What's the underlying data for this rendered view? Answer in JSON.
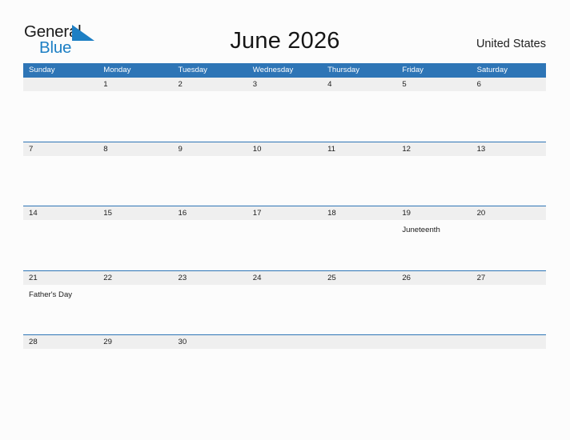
{
  "brand": {
    "name_part1": "General",
    "name_part2": "Blue",
    "flag_icon": "blue-triangle-flag-icon",
    "accent_color": "#1d7fc4"
  },
  "header": {
    "title": "June 2026",
    "country": "United States"
  },
  "theme": {
    "header_blue": "#2e75b6",
    "date_band_gray": "#efefef",
    "page_background": "#fcfcfc",
    "text_color": "#1c1c1c"
  },
  "calendar": {
    "month": "June",
    "year": "2026",
    "weekdays": [
      "Sunday",
      "Monday",
      "Tuesday",
      "Wednesday",
      "Thursday",
      "Friday",
      "Saturday"
    ],
    "weeks": [
      [
        {
          "date": "",
          "event": ""
        },
        {
          "date": "1",
          "event": ""
        },
        {
          "date": "2",
          "event": ""
        },
        {
          "date": "3",
          "event": ""
        },
        {
          "date": "4",
          "event": ""
        },
        {
          "date": "5",
          "event": ""
        },
        {
          "date": "6",
          "event": ""
        }
      ],
      [
        {
          "date": "7",
          "event": ""
        },
        {
          "date": "8",
          "event": ""
        },
        {
          "date": "9",
          "event": ""
        },
        {
          "date": "10",
          "event": ""
        },
        {
          "date": "11",
          "event": ""
        },
        {
          "date": "12",
          "event": ""
        },
        {
          "date": "13",
          "event": ""
        }
      ],
      [
        {
          "date": "14",
          "event": ""
        },
        {
          "date": "15",
          "event": ""
        },
        {
          "date": "16",
          "event": ""
        },
        {
          "date": "17",
          "event": ""
        },
        {
          "date": "18",
          "event": ""
        },
        {
          "date": "19",
          "event": "Juneteenth"
        },
        {
          "date": "20",
          "event": ""
        }
      ],
      [
        {
          "date": "21",
          "event": "Father's Day"
        },
        {
          "date": "22",
          "event": ""
        },
        {
          "date": "23",
          "event": ""
        },
        {
          "date": "24",
          "event": ""
        },
        {
          "date": "25",
          "event": ""
        },
        {
          "date": "26",
          "event": ""
        },
        {
          "date": "27",
          "event": ""
        }
      ],
      [
        {
          "date": "28",
          "event": ""
        },
        {
          "date": "29",
          "event": ""
        },
        {
          "date": "30",
          "event": ""
        },
        {
          "date": "",
          "event": ""
        },
        {
          "date": "",
          "event": ""
        },
        {
          "date": "",
          "event": ""
        },
        {
          "date": "",
          "event": ""
        }
      ]
    ]
  }
}
